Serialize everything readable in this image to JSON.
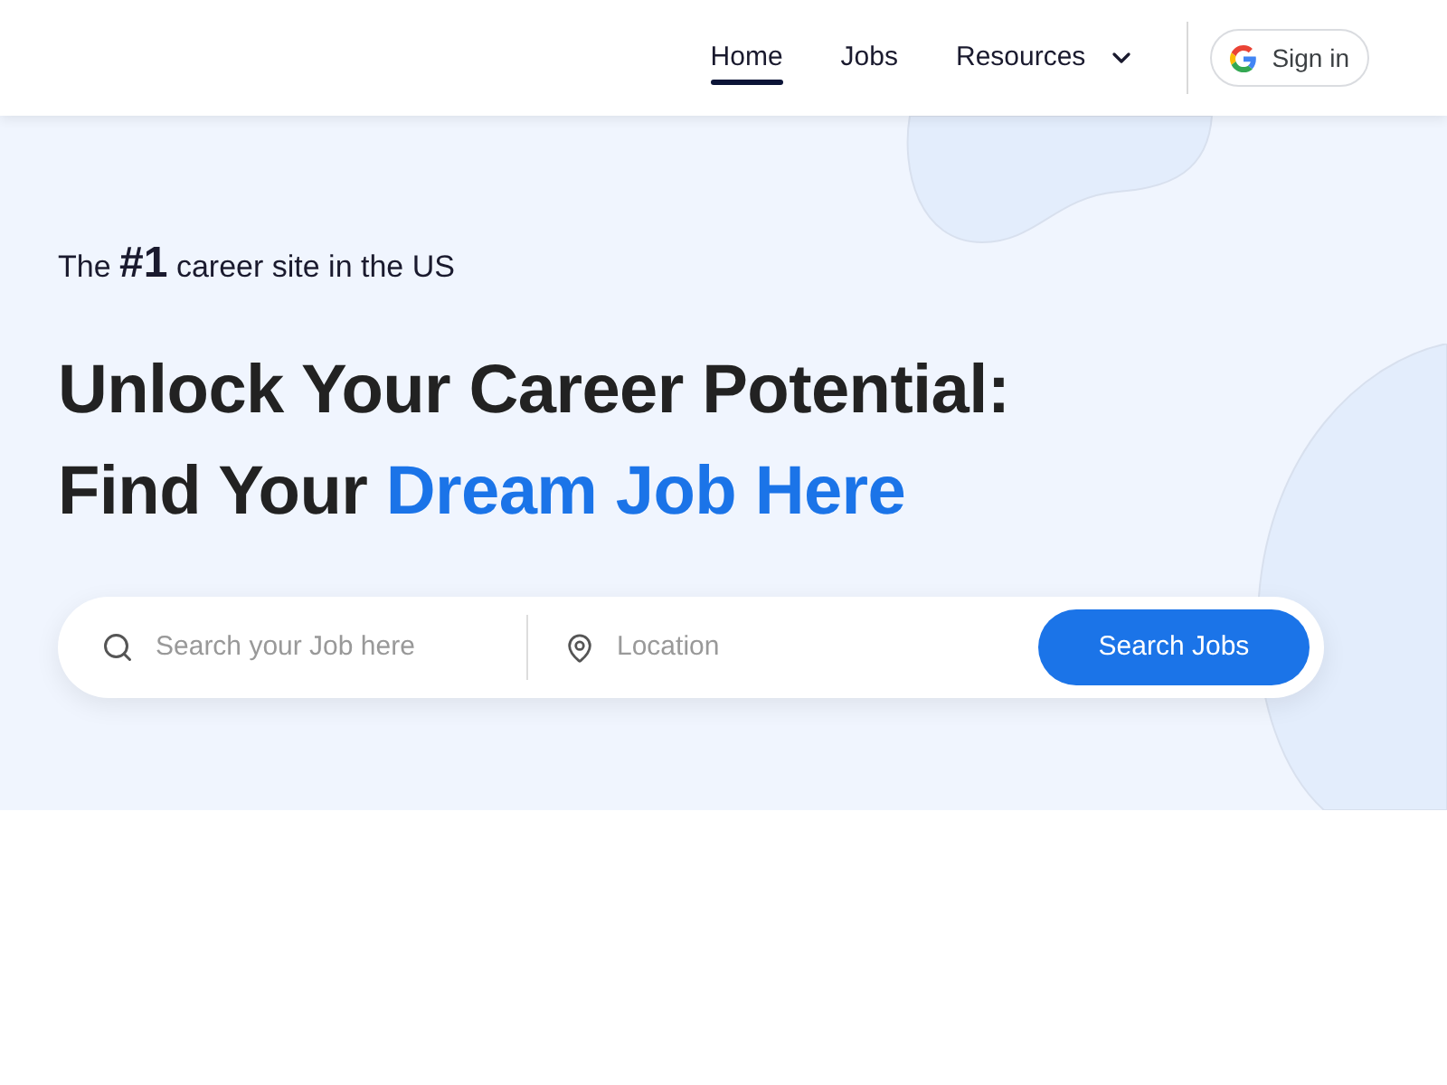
{
  "nav": {
    "items": [
      {
        "label": "Home",
        "selected": true,
        "kind": "link"
      },
      {
        "label": "Jobs",
        "selected": false,
        "kind": "link"
      },
      {
        "label": "Resources",
        "selected": false,
        "kind": "dropdown"
      }
    ],
    "sign_in": {
      "label": "Sign in"
    }
  },
  "hero": {
    "tagline": "The **#1** career site in the US",
    "headline_line_1": "Unlock Your Career Potential:",
    "headline_line_2": "Find Your",
    "headline_highlight": "Dream Job Here"
  },
  "search": {
    "job_placeholder": "Search your Job here",
    "location_placeholder": "Location",
    "button": "Search Jobs"
  }
}
